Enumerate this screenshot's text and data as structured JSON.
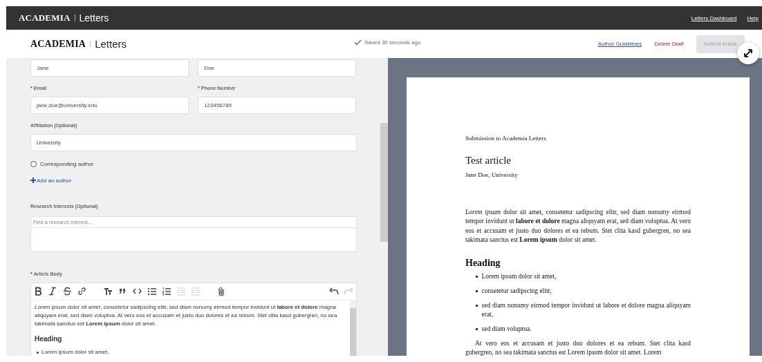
{
  "top_bar": {
    "brand": "ACADEMIA",
    "product": "Letters",
    "links": [
      "Letters Dashboard",
      "Help"
    ]
  },
  "header": {
    "brand": "ACADEMIA",
    "product": "Letters",
    "save_status": "Saved 30 seconds ago",
    "links": [
      {
        "label": "Author Guidelines",
        "kind": "link"
      },
      {
        "label": "Delete Draft",
        "kind": "danger"
      }
    ],
    "submit": {
      "label": "Submit Article",
      "disabled": true
    }
  },
  "form": {
    "rows": [
      {
        "fields": [
          {
            "value": "Jane"
          },
          {
            "value": "Doe"
          }
        ]
      },
      {
        "fields": [
          {
            "marker": "*",
            "label": "Email",
            "value": "jane.doe@university.edu"
          },
          {
            "marker": "*",
            "label": "Phone Number",
            "value": "123456789"
          }
        ]
      },
      {
        "fields": [
          {
            "label": "Affiliation (Optional)",
            "value": "University"
          }
        ]
      }
    ],
    "corresponding": {
      "label": "Corresponding author",
      "checked": false
    },
    "add_author": "Add an author",
    "interests": {
      "label": "Research Interests (Optional)",
      "placeholder": "Find a research interest..."
    },
    "body": {
      "marker": "*",
      "label": "Article Body",
      "toolbar": [
        {
          "tools": [
            {
              "kind": "bold",
              "disabled": false
            },
            {
              "kind": "italic",
              "disabled": false
            },
            {
              "kind": "strike",
              "disabled": false
            },
            {
              "kind": "link",
              "disabled": false
            }
          ]
        },
        {
          "tools": [
            {
              "kind": "size",
              "disabled": false
            },
            {
              "kind": "quote",
              "disabled": false
            },
            {
              "kind": "code",
              "disabled": false
            },
            {
              "kind": "bullets",
              "disabled": false
            },
            {
              "kind": "numbers",
              "disabled": false
            },
            {
              "kind": "outdent",
              "disabled": true
            },
            {
              "kind": "indent",
              "disabled": true
            }
          ]
        },
        {
          "tools": [
            {
              "kind": "attach",
              "disabled": false
            }
          ]
        },
        {
          "tools": [
            {
              "kind": "undo",
              "disabled": false
            },
            {
              "kind": "redo",
              "disabled": true
            }
          ]
        }
      ],
      "paragraph": "*Lorem ipsum* dolor sit amet, consetetur sadipscing elitr, sed diam nonumy eirmod tempor invidunt ut **labore et dolore** magna aliquyam erat, sed diam voluptua. At vero eos et accusam et justo duo dolores et ea rebum. Stet clita kasd gubergren, no sea takimata sanctus est **Lorem ipsum** dolor sit amet.",
      "heading": "Heading",
      "items": [
        "Lorem ipsum dolor sit amet,"
      ]
    }
  },
  "preview": {
    "journal": "Submission to Academia Letters",
    "title": "Test article",
    "byline": "Jane Doe, University",
    "paragraph": "*Lorem ipsum* dolor sit amet, consetetur sadipscing elitr, sed diam nonumy eirmod tempor invidunt ut **labore et dolore** magna aliquyam erat, sed diam voluptua. At vero eos et accusam et justo duo dolores et ea rebum. Stet clita kasd gubergren, no sea takimata sanctus est **Lorem ipsum** dolor sit amet.",
    "heading": "Heading",
    "items": [
      "Lorem ipsum dolor sit amet,",
      "consetetur sadipscing elitr,",
      "sed diam nonumy eirmod tempor invidunt ut labore et dolore magna aliquyam erat,",
      "sed diam voluptua."
    ],
    "closing": "At vero eos et accusam et justo duo dolores et ea rebum. Stet clita kasd gubergren, no sea takimata sanctus est Lorem ipsum dolor sit amet. Lorem"
  }
}
